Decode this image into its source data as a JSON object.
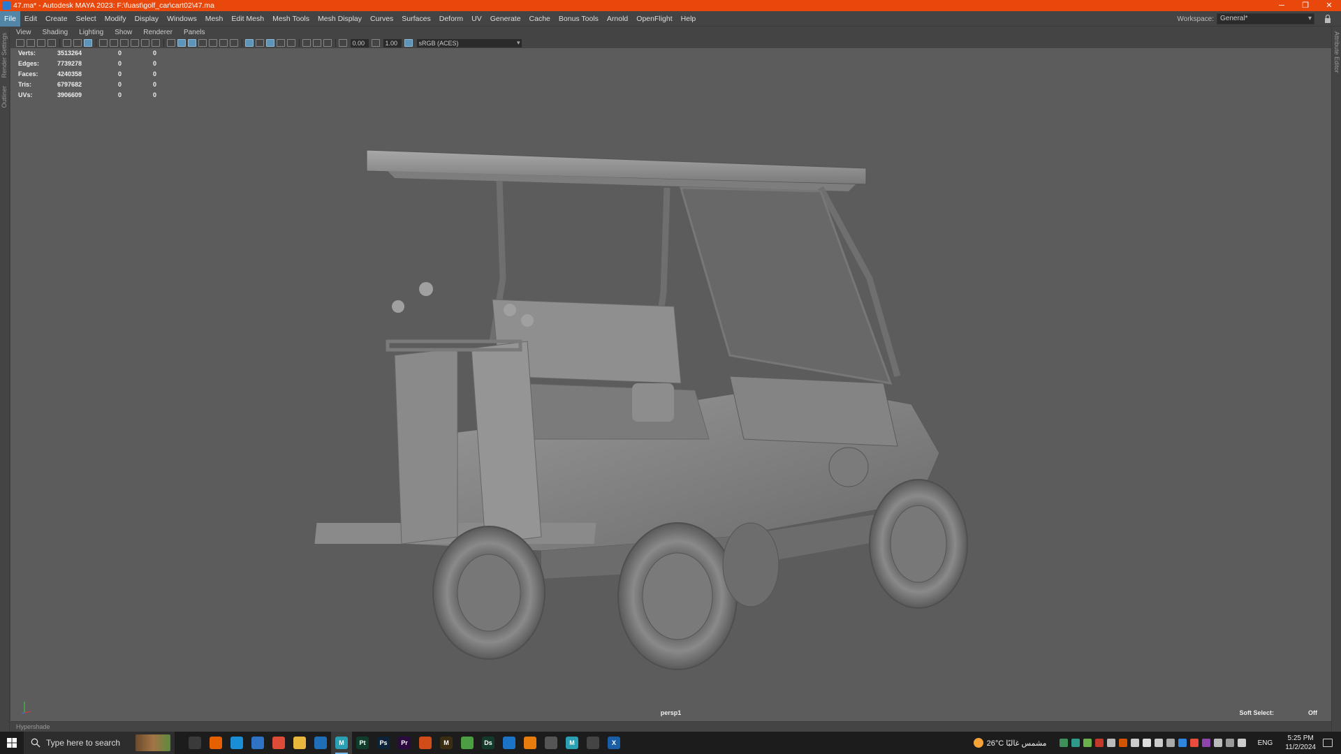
{
  "window": {
    "title": "47.ma* - Autodesk MAYA 2023: F:\\fuast\\golf_car\\cart02\\47.ma",
    "minimize_glyph": "─",
    "restore_glyph": "❐",
    "close_glyph": "✕"
  },
  "menubar": {
    "items": [
      "File",
      "Edit",
      "Create",
      "Select",
      "Modify",
      "Display",
      "Windows",
      "Mesh",
      "Edit Mesh",
      "Mesh Tools",
      "Mesh Display",
      "Curves",
      "Surfaces",
      "Deform",
      "UV",
      "Generate",
      "Cache",
      "Bonus Tools",
      "Arnold",
      "OpenFlight",
      "Help"
    ],
    "active_item": "File"
  },
  "workspace": {
    "label": "Workspace:",
    "value": "General*"
  },
  "side_tabs": {
    "render_settings": "Render Settings",
    "outliner": "Outliner",
    "attribute_editor": "Attribute Editor"
  },
  "panel_menu": {
    "items": [
      "View",
      "Shading",
      "Lighting",
      "Show",
      "Renderer",
      "Panels"
    ]
  },
  "panel_toolbar": {
    "exposure": "0.00",
    "gamma": "1.00",
    "color_space": "sRGB (ACES)"
  },
  "hud": {
    "rows": [
      {
        "label": "Verts:",
        "v1": "3513264",
        "v2": "0",
        "v3": "0"
      },
      {
        "label": "Edges:",
        "v1": "7739278",
        "v2": "0",
        "v3": "0"
      },
      {
        "label": "Faces:",
        "v1": "4240358",
        "v2": "0",
        "v3": "0"
      },
      {
        "label": "Tris:",
        "v1": "6797682",
        "v2": "0",
        "v3": "0"
      },
      {
        "label": "UVs:",
        "v1": "3906609",
        "v2": "0",
        "v3": "0"
      }
    ]
  },
  "viewport": {
    "camera": "persp1",
    "soft_select_label": "Soft Select:",
    "soft_select_value": "Off",
    "background_color": "#5c5c5c"
  },
  "bottom_panel": {
    "hypershade": "Hypershade"
  },
  "taskbar": {
    "search_placeholder": "Type here to search",
    "apps": [
      {
        "name": "task-view",
        "label": "",
        "color": "#3a3a3a"
      },
      {
        "name": "firefox",
        "label": "",
        "color": "#e66000"
      },
      {
        "name": "edge",
        "label": "",
        "color": "#1b8fd6"
      },
      {
        "name": "store",
        "label": "",
        "color": "#2f73c7"
      },
      {
        "name": "chrome",
        "label": "",
        "color": "#dd4b39"
      },
      {
        "name": "file-explorer",
        "label": "",
        "color": "#e8b73b"
      },
      {
        "name": "app-blue",
        "label": "",
        "color": "#1e6fb5"
      },
      {
        "name": "maya",
        "label": "M",
        "color": "#2b9fb3"
      },
      {
        "name": "painter",
        "label": "Pt",
        "color": "#0f3d2b"
      },
      {
        "name": "photoshop",
        "label": "Ps",
        "color": "#0b2238"
      },
      {
        "name": "premiere",
        "label": "Pr",
        "color": "#2a0a3f"
      },
      {
        "name": "app-orange",
        "label": "",
        "color": "#d24c1a"
      },
      {
        "name": "marmoset",
        "label": "M",
        "color": "#3b2d12"
      },
      {
        "name": "maps",
        "label": "",
        "color": "#4c9e42"
      },
      {
        "name": "designer",
        "label": "Ds",
        "color": "#123b2b"
      },
      {
        "name": "app-ring",
        "label": "",
        "color": "#1b74c7"
      },
      {
        "name": "blender",
        "label": "",
        "color": "#e87d0d"
      },
      {
        "name": "zbrush",
        "label": "",
        "color": "#555555"
      },
      {
        "name": "maya-2",
        "label": "M",
        "color": "#2b9fb3"
      },
      {
        "name": "app-gray",
        "label": "",
        "color": "#444444"
      },
      {
        "name": "app-x",
        "label": "X",
        "color": "#1a5ea8"
      }
    ],
    "weather": "26°C  مشمس غالبًا",
    "language": "ENG",
    "time": "5:25 PM",
    "date": "11/2/2024"
  },
  "colors": {
    "titlebar": "#e8480c",
    "menu_active": "#5285a6",
    "ui_bg": "#444444"
  }
}
